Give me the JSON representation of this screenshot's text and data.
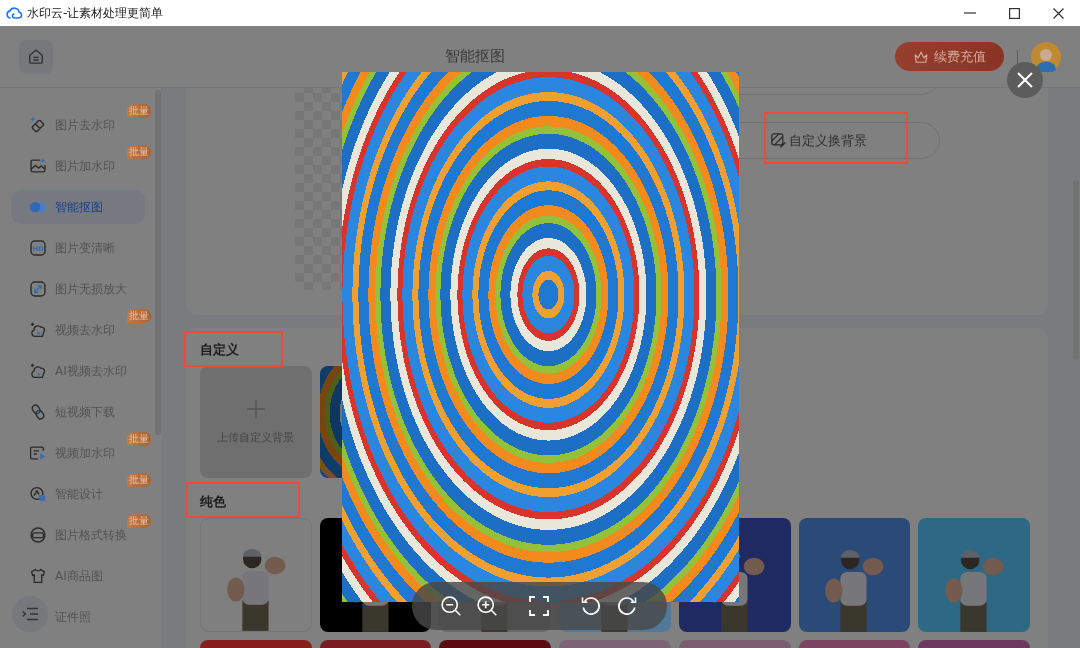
{
  "window": {
    "title": "水印云-让素材处理更简单"
  },
  "header": {
    "title": "智能抠图",
    "recharge_button": "续费充值"
  },
  "sidebar": {
    "items": [
      {
        "label": "图片去水印",
        "badge": "批量",
        "selected": false
      },
      {
        "label": "图片加水印",
        "badge": "批量",
        "selected": false
      },
      {
        "label": "智能抠图",
        "selected": true
      },
      {
        "label": "图片变清晰",
        "icon_text": "HD",
        "selected": false
      },
      {
        "label": "图片无损放大",
        "selected": false
      },
      {
        "label": "视频去水印",
        "badge": "批量",
        "selected": false
      },
      {
        "label": "AI视频去水印",
        "selected": false
      },
      {
        "label": "短视频下载",
        "selected": false
      },
      {
        "label": "视频加水印",
        "badge": "批量",
        "selected": false
      },
      {
        "label": "智能设计",
        "badge": "批量",
        "selected": false
      },
      {
        "label": "图片格式转换",
        "badge": "批量",
        "selected": false
      },
      {
        "label": "AI商品图",
        "selected": false
      },
      {
        "label": "证件照",
        "selected": false
      }
    ]
  },
  "preview_card": {
    "option_button": {
      "label": "自定义换背景",
      "highlighted": true
    }
  },
  "custom_section": {
    "title": "自定义",
    "highlighted": true,
    "upload_tile": {
      "label": "上传自定义背景"
    }
  },
  "solid_section": {
    "title": "纯色",
    "highlighted": true,
    "swatches": [
      {
        "color": "#7f7f7f"
      },
      {
        "color": "#000000"
      },
      {
        "color": "#6a6a6a"
      },
      {
        "color": "#52789a"
      },
      {
        "color": "#1f2a62"
      },
      {
        "color": "#2a4a78"
      },
      {
        "color": "#2d6885"
      },
      {
        "color": "#871e1e"
      },
      {
        "color": "#7a1c22"
      },
      {
        "color": "#5c0c10"
      },
      {
        "color": "#7c6474"
      },
      {
        "color": "#7a5e70"
      },
      {
        "color": "#7c4460"
      },
      {
        "color": "#6c3a5e"
      }
    ]
  }
}
